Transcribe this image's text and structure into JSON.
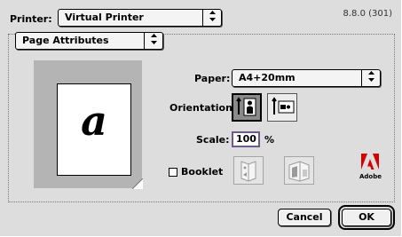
{
  "printer": {
    "label": "Printer:",
    "selected": "Virtual Printer",
    "version": "8.8.0 (301)"
  },
  "panel": {
    "selected": "Page Attributes"
  },
  "preview": {
    "glyph": "a"
  },
  "paper": {
    "label": "Paper:",
    "selected": "A4+20mm"
  },
  "orientation": {
    "label": "Orientation:",
    "options": [
      "portrait-icon",
      "landscape-icon"
    ],
    "selected": "portrait"
  },
  "scale": {
    "label": "Scale:",
    "value": "100",
    "unit": "%"
  },
  "booklet": {
    "label": "Booklet",
    "checked": false
  },
  "brand": {
    "word": "Adobe",
    "color": "#d40000"
  },
  "buttons": {
    "cancel": "Cancel",
    "ok": "OK"
  },
  "arrows_glyph": "⇕"
}
